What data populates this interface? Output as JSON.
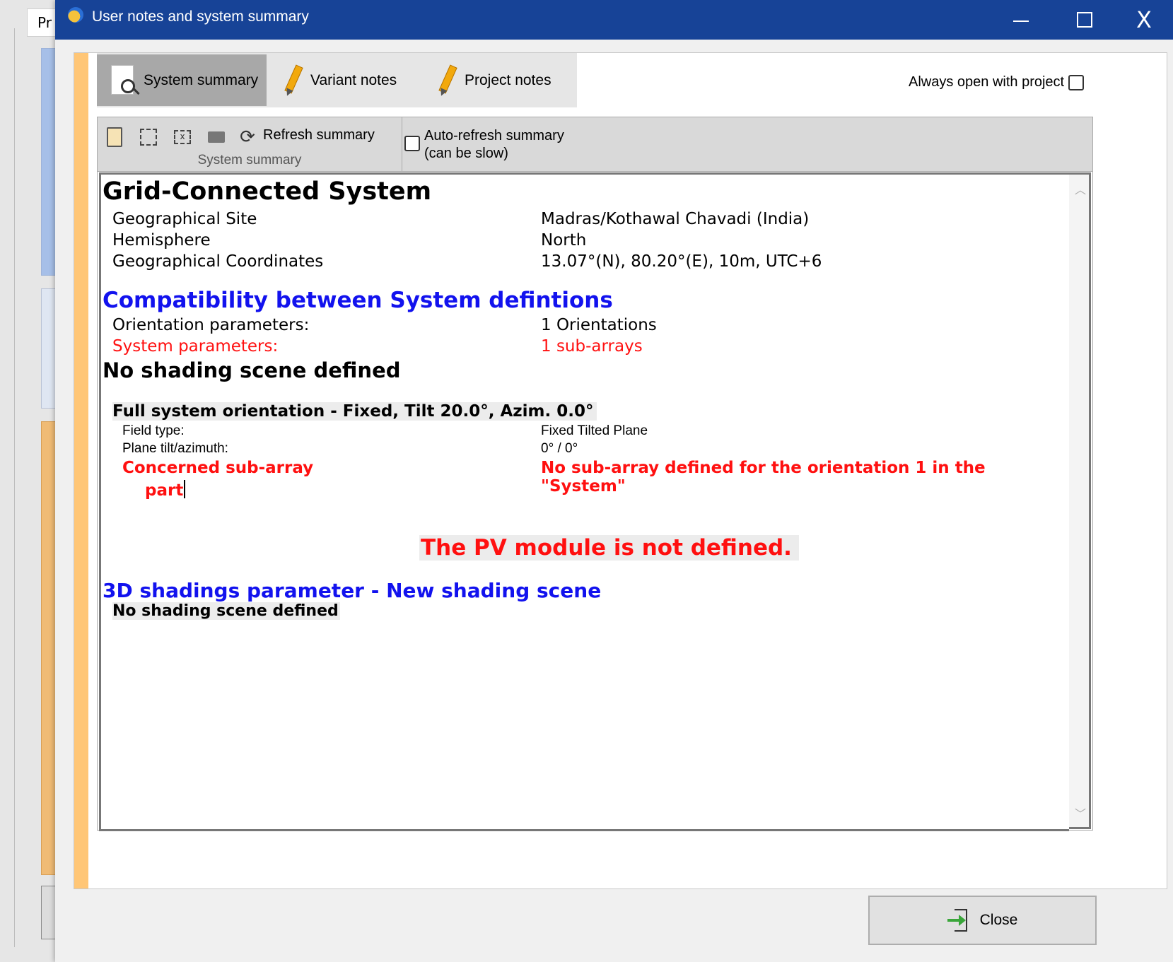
{
  "background": {
    "tab_label": "Pr"
  },
  "window": {
    "title": "User notes and system summary",
    "minimize": "—",
    "close": "X"
  },
  "tabs": [
    {
      "label": "System summary",
      "active": true
    },
    {
      "label": "Variant notes",
      "active": false
    },
    {
      "label": "Project notes",
      "active": false
    }
  ],
  "always_open": {
    "label": "Always open with project",
    "checked": false
  },
  "toolbar": {
    "refresh_label": "Refresh summary",
    "group_label": "System summary",
    "auto_refresh_line1": "Auto-refresh summary",
    "auto_refresh_line2": "(can be slow)",
    "auto_refresh_checked": false
  },
  "summary": {
    "title": "Grid-Connected System",
    "site_label": "Geographical Site",
    "site_value": "Madras/Kothawal Chavadi (India)",
    "hemisphere_label": "Hemisphere",
    "hemisphere_value": "North",
    "coords_label": "Geographical Coordinates",
    "coords_value": "13.07°(N), 80.20°(E), 10m, UTC+6",
    "compat_title": "Compatibility between System defintions",
    "orient_label": "Orientation parameters:",
    "orient_value": "1 Orientations",
    "system_label": "System parameters:",
    "system_value": "1 sub-arrays",
    "no_shading": "No shading scene defined",
    "orientation_heading": "Full system orientation - Fixed, Tilt 20.0°, Azim. 0.0°",
    "field_type_label": "Field type:",
    "field_type_value": "Fixed Tilted Plane",
    "plane_label": "Plane tilt/azimuth:",
    "plane_value": "0° / 0°",
    "concerned_label_1": "Concerned sub-array",
    "concerned_label_2": "part",
    "concerned_value": "No sub-array defined for the orientation 1 in the \"System\"",
    "pv_module": "The PV module is not defined.",
    "shadings_title": "3D shadings parameter - New shading scene",
    "shadings_value": "No shading scene defined"
  },
  "close_button": {
    "label": "Close"
  },
  "colors": {
    "titlebar": "#174397",
    "heading_blue": "#1212ee",
    "error_red": "#ff1010",
    "stripe": "#ffc676"
  }
}
